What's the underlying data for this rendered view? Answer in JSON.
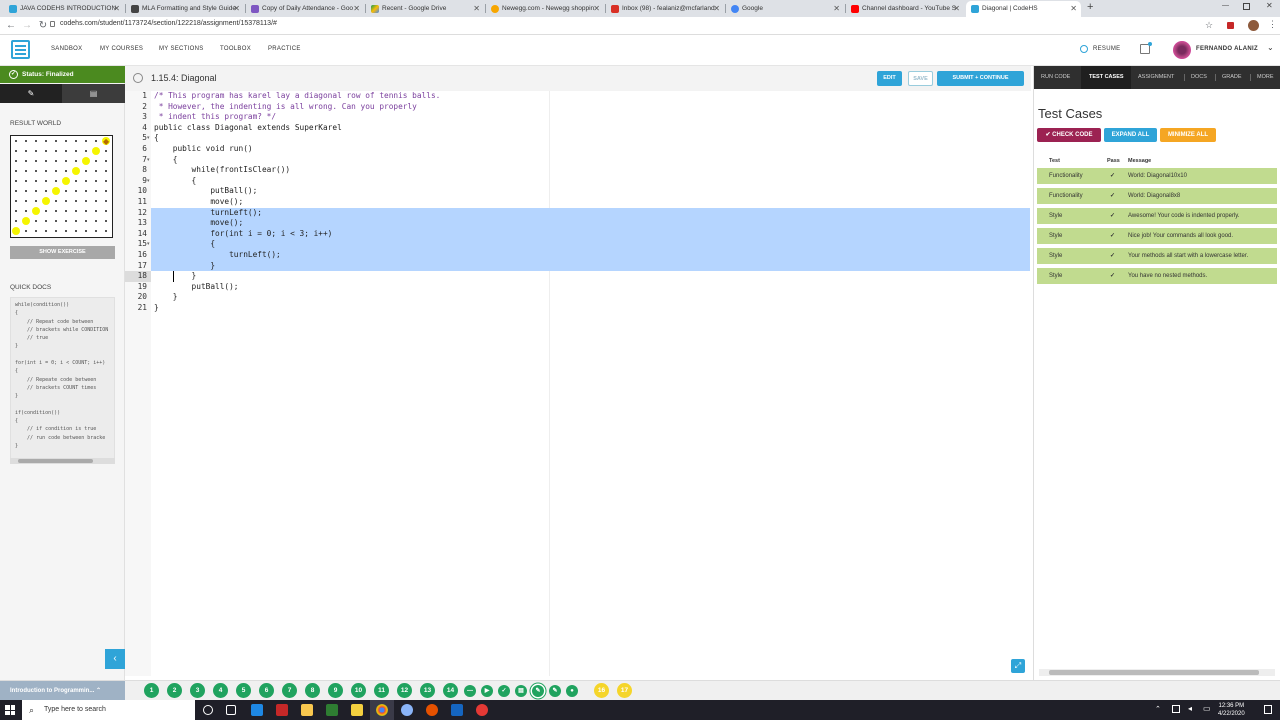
{
  "browser": {
    "tabs": [
      {
        "title": "JAVA CODEHS INTRODUCTION"
      },
      {
        "title": "MLA Formatting and Style Guide"
      },
      {
        "title": "Copy of Daily Attendance - Goo"
      },
      {
        "title": "Recent - Google Drive"
      },
      {
        "title": "Newegg.com - Newegg shoppin"
      },
      {
        "title": "Inbox (98) - fealaniz@mcfarland"
      },
      {
        "title": "Google"
      },
      {
        "title": "Channel dashboard - YouTube S"
      },
      {
        "title": "Diagonal | CodeHS"
      }
    ],
    "url": "codehs.com/student/1173724/section/122218/assignment/15378113/#"
  },
  "header": {
    "nav": [
      "SANDBOX",
      "MY COURSES",
      "MY SECTIONS",
      "TOOLBOX",
      "PRACTICE"
    ],
    "resume": "RESUME",
    "user": "FERNANDO ALANIZ"
  },
  "left": {
    "status": "Status: Finalized",
    "result_world": "RESULT WORLD",
    "show_exercise": "SHOW EXERCISE",
    "quick_docs": "QUICK DOCS",
    "docs_text": "while(condition())\n{\n    // Repeat code between\n    // brackets while CONDITION\n    // true\n}\n\nfor(int i = 0; i < COUNT; i++)\n{\n    // Repeate code between\n    // brackets COUNT times\n}\n\nif(condition())\n{\n    // if condition is true\n    // run code between bracke\n}"
  },
  "editor": {
    "title": "1.15.4: Diagonal",
    "edit": "EDIT",
    "save": "SAVE",
    "submit": "SUBMIT + CONTINUE",
    "lines": [
      "/* This program has karel lay a diagonal row of tennis balls.",
      " * However, the indenting is all wrong. Can you properly",
      " * indent this program? */",
      "public class Diagonal extends SuperKarel",
      "{",
      "    public void run()",
      "    {",
      "        while(frontIsClear())",
      "        {",
      "            putBall();",
      "            move();",
      "            turnLeft();",
      "            move();",
      "            for(int i = 0; i < 3; i++)",
      "            {",
      "                turnLeft();",
      "            }",
      "        }",
      "        putBall();",
      "    }",
      "}"
    ]
  },
  "right": {
    "tabs": [
      "RUN CODE",
      "TEST CASES",
      "ASSIGNMENT",
      "DOCS",
      "GRADE",
      "MORE"
    ],
    "title": "Test Cases",
    "buttons": {
      "check": "✔ CHECK CODE",
      "expand": "EXPAND ALL",
      "minimize": "MINIMIZE ALL"
    },
    "headers": {
      "test": "Test",
      "pass": "Pass",
      "message": "Message"
    },
    "rows": [
      {
        "test": "Functionality",
        "pass": "✓",
        "message": "World: Diagonal10x10"
      },
      {
        "test": "Functionality",
        "pass": "✓",
        "message": "World: Diagonal8x8"
      },
      {
        "test": "Style",
        "pass": "✓",
        "message": "Awesome! Your code is indented properly."
      },
      {
        "test": "Style",
        "pass": "✓",
        "message": "Nice job! Your commands all look good."
      },
      {
        "test": "Style",
        "pass": "✓",
        "message": "Your methods all start with a lowercase letter."
      },
      {
        "test": "Style",
        "pass": "✓",
        "message": "You have no nested methods."
      }
    ]
  },
  "coursebar": {
    "name": "Introduction to Programmin...",
    "steps": [
      "1",
      "2",
      "3",
      "4",
      "5",
      "6",
      "7",
      "8",
      "9",
      "10",
      "11",
      "12",
      "13",
      "14"
    ],
    "extra_steps": [
      "16",
      "17"
    ]
  },
  "taskbar": {
    "search": "Type here to search",
    "time": "12:36 PM",
    "date": "4/22/2020"
  },
  "colors": {
    "accent": "#2fa4d8",
    "finalized": "#4b8a1f",
    "pass_row": "#c1db8f",
    "check_code": "#9c2252",
    "minimize": "#f5a623",
    "selection": "#b5d5ff"
  }
}
